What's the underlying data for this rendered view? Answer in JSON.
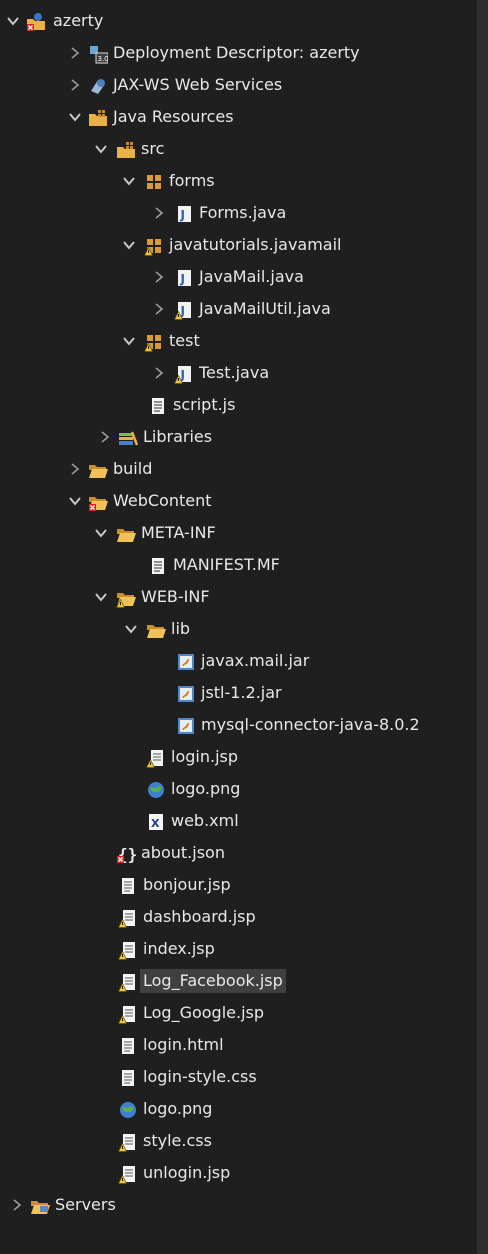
{
  "tree": [
    {
      "label": "azerty",
      "expanded": true,
      "icon": "web-project-error-icon"
    },
    {
      "label": "Deployment Descriptor: azerty",
      "expanded": false,
      "icon": "deployment-descriptor-icon"
    },
    {
      "label": "JAX-WS Web Services",
      "expanded": false,
      "icon": "web-services-icon"
    },
    {
      "label": "Java Resources",
      "expanded": true,
      "icon": "java-resources-icon"
    },
    {
      "label": "src",
      "expanded": true,
      "icon": "source-folder-icon"
    },
    {
      "label": "forms",
      "expanded": true,
      "icon": "package-icon"
    },
    {
      "label": "Forms.java",
      "expanded": false,
      "icon": "java-file-icon"
    },
    {
      "label": "javatutorials.javamail",
      "expanded": true,
      "icon": "package-warning-icon"
    },
    {
      "label": "JavaMail.java",
      "expanded": false,
      "icon": "java-file-icon"
    },
    {
      "label": "JavaMailUtil.java",
      "expanded": false,
      "icon": "java-file-warning-icon"
    },
    {
      "label": "test",
      "expanded": true,
      "icon": "package-warning-icon"
    },
    {
      "label": "Test.java",
      "expanded": false,
      "icon": "java-file-warning-icon"
    },
    {
      "label": "script.js",
      "icon": "text-file-icon"
    },
    {
      "label": "Libraries",
      "expanded": false,
      "icon": "libraries-icon"
    },
    {
      "label": "build",
      "expanded": false,
      "icon": "folder-icon"
    },
    {
      "label": "WebContent",
      "expanded": true,
      "icon": "folder-error-icon"
    },
    {
      "label": "META-INF",
      "expanded": true,
      "icon": "folder-icon"
    },
    {
      "label": "MANIFEST.MF",
      "icon": "text-file-icon"
    },
    {
      "label": "WEB-INF",
      "expanded": true,
      "icon": "folder-warning-icon"
    },
    {
      "label": "lib",
      "expanded": true,
      "icon": "folder-icon"
    },
    {
      "label": "javax.mail.jar",
      "icon": "jar-file-icon"
    },
    {
      "label": "jstl-1.2.jar",
      "icon": "jar-file-icon"
    },
    {
      "label": "mysql-connector-java-8.0.2",
      "icon": "jar-file-icon"
    },
    {
      "label": "login.jsp",
      "icon": "jsp-file-warning-icon"
    },
    {
      "label": "logo.png",
      "icon": "image-file-icon"
    },
    {
      "label": "web.xml",
      "icon": "xml-file-icon"
    },
    {
      "label": "about.json",
      "icon": "json-file-error-icon"
    },
    {
      "label": "bonjour.jsp",
      "icon": "jsp-file-icon"
    },
    {
      "label": "dashboard.jsp",
      "icon": "jsp-file-warning-icon"
    },
    {
      "label": "index.jsp",
      "icon": "jsp-file-warning-icon"
    },
    {
      "label": "Log_Facebook.jsp",
      "icon": "jsp-file-warning-icon",
      "selected": true
    },
    {
      "label": "Log_Google.jsp",
      "icon": "jsp-file-warning-icon"
    },
    {
      "label": "login.html",
      "icon": "html-file-icon"
    },
    {
      "label": "login-style.css",
      "icon": "css-file-icon"
    },
    {
      "label": "logo.png",
      "icon": "image-file-icon"
    },
    {
      "label": "style.css",
      "icon": "css-file-warning-icon"
    },
    {
      "label": "unlogin.jsp",
      "icon": "jsp-file-warning-icon"
    },
    {
      "label": "Servers",
      "expanded": false,
      "icon": "folder-icon"
    }
  ]
}
